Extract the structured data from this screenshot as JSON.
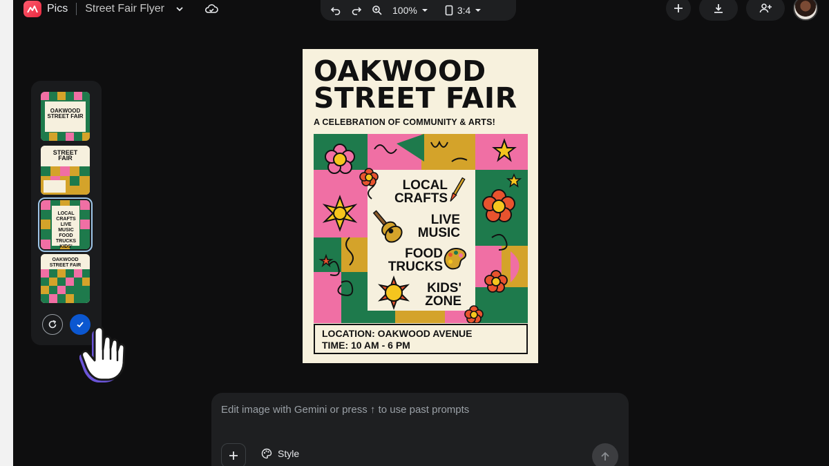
{
  "topbar": {
    "app_name": "Pics",
    "doc_title": "Street Fair Flyer",
    "zoom": "100%",
    "aspect_ratio": "3:4",
    "icons": [
      "pics-logo-icon",
      "chevron-down-icon",
      "cloud-sync-icon",
      "undo-icon",
      "redo-icon",
      "zoom-icon",
      "chevron-down-icon",
      "portrait-icon",
      "chevron-down-icon",
      "plus-icon",
      "download-icon",
      "add-person-icon"
    ]
  },
  "variants": {
    "thumbnails": [
      {
        "text": "OAKWOOD STREET FAIR",
        "selected": false
      },
      {
        "text": "STREET FAIR",
        "selected": false
      },
      {
        "text": "LOCAL CRAFTS LIVE MUSIC FOOD TRUCKS KIDS' ZONE",
        "selected": true
      },
      {
        "text": "OAKWOOD STREET FAIR",
        "selected": false
      }
    ]
  },
  "poster": {
    "title_line1": "OAKWOOD",
    "title_line2": "STREET FAIR",
    "subtitle": "A CELEBRATION OF COMMUNITY & ARTS!",
    "feature1_l1": "LOCAL",
    "feature1_l2": "CRAFTS",
    "feature2_l1": "LIVE",
    "feature2_l2": "MUSIC",
    "feature3_l1": "FOOD",
    "feature3_l2": "TRUCKS",
    "feature4_l1": "KIDS'",
    "feature4_l2": "ZONE",
    "location": "LOCATION: OAKWOOD AVENUE",
    "time": "TIME: 10 AM - 6 PM",
    "colors": {
      "cream": "#f7f1dd",
      "green": "#1e7a4c",
      "pink": "#f06fa4",
      "mustard": "#d4a32a",
      "orange": "#e8532e",
      "yellow": "#f5c51e"
    }
  },
  "prompt": {
    "placeholder": "Edit image with Gemini or press ↑ to use past prompts",
    "style_label": "Style"
  },
  "colors": {
    "background": "#0e0e0f",
    "panel": "#1e1f21",
    "accent_blue": "#0b57d0",
    "selection": "#9fc6e8"
  }
}
